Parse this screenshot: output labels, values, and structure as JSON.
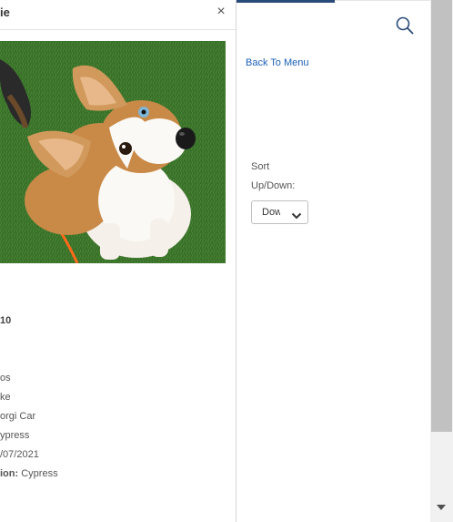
{
  "dialog": {
    "title": "ie",
    "close_glyph": "×",
    "photo_alt": "",
    "details": [
      {
        "text": "10",
        "bold": true
      },
      {
        "text": "os",
        "bold": false
      },
      {
        "text": "ke",
        "bold": false
      },
      {
        "text": "orgi Car",
        "bold": false
      },
      {
        "text": "ypress",
        "bold": false
      },
      {
        "text": "/07/2021",
        "bold": false
      }
    ],
    "location_label": "ion:",
    "location_value": " Cypress"
  },
  "sidebar": {
    "search_icon": "search-icon",
    "back_link": "Back To Menu",
    "sort_label_line1": "Sort",
    "sort_label_line2": "Up/Down:",
    "sort_selected": "Down",
    "accent_color": "#2a4a7a",
    "link_color": "#1a5fb4"
  }
}
